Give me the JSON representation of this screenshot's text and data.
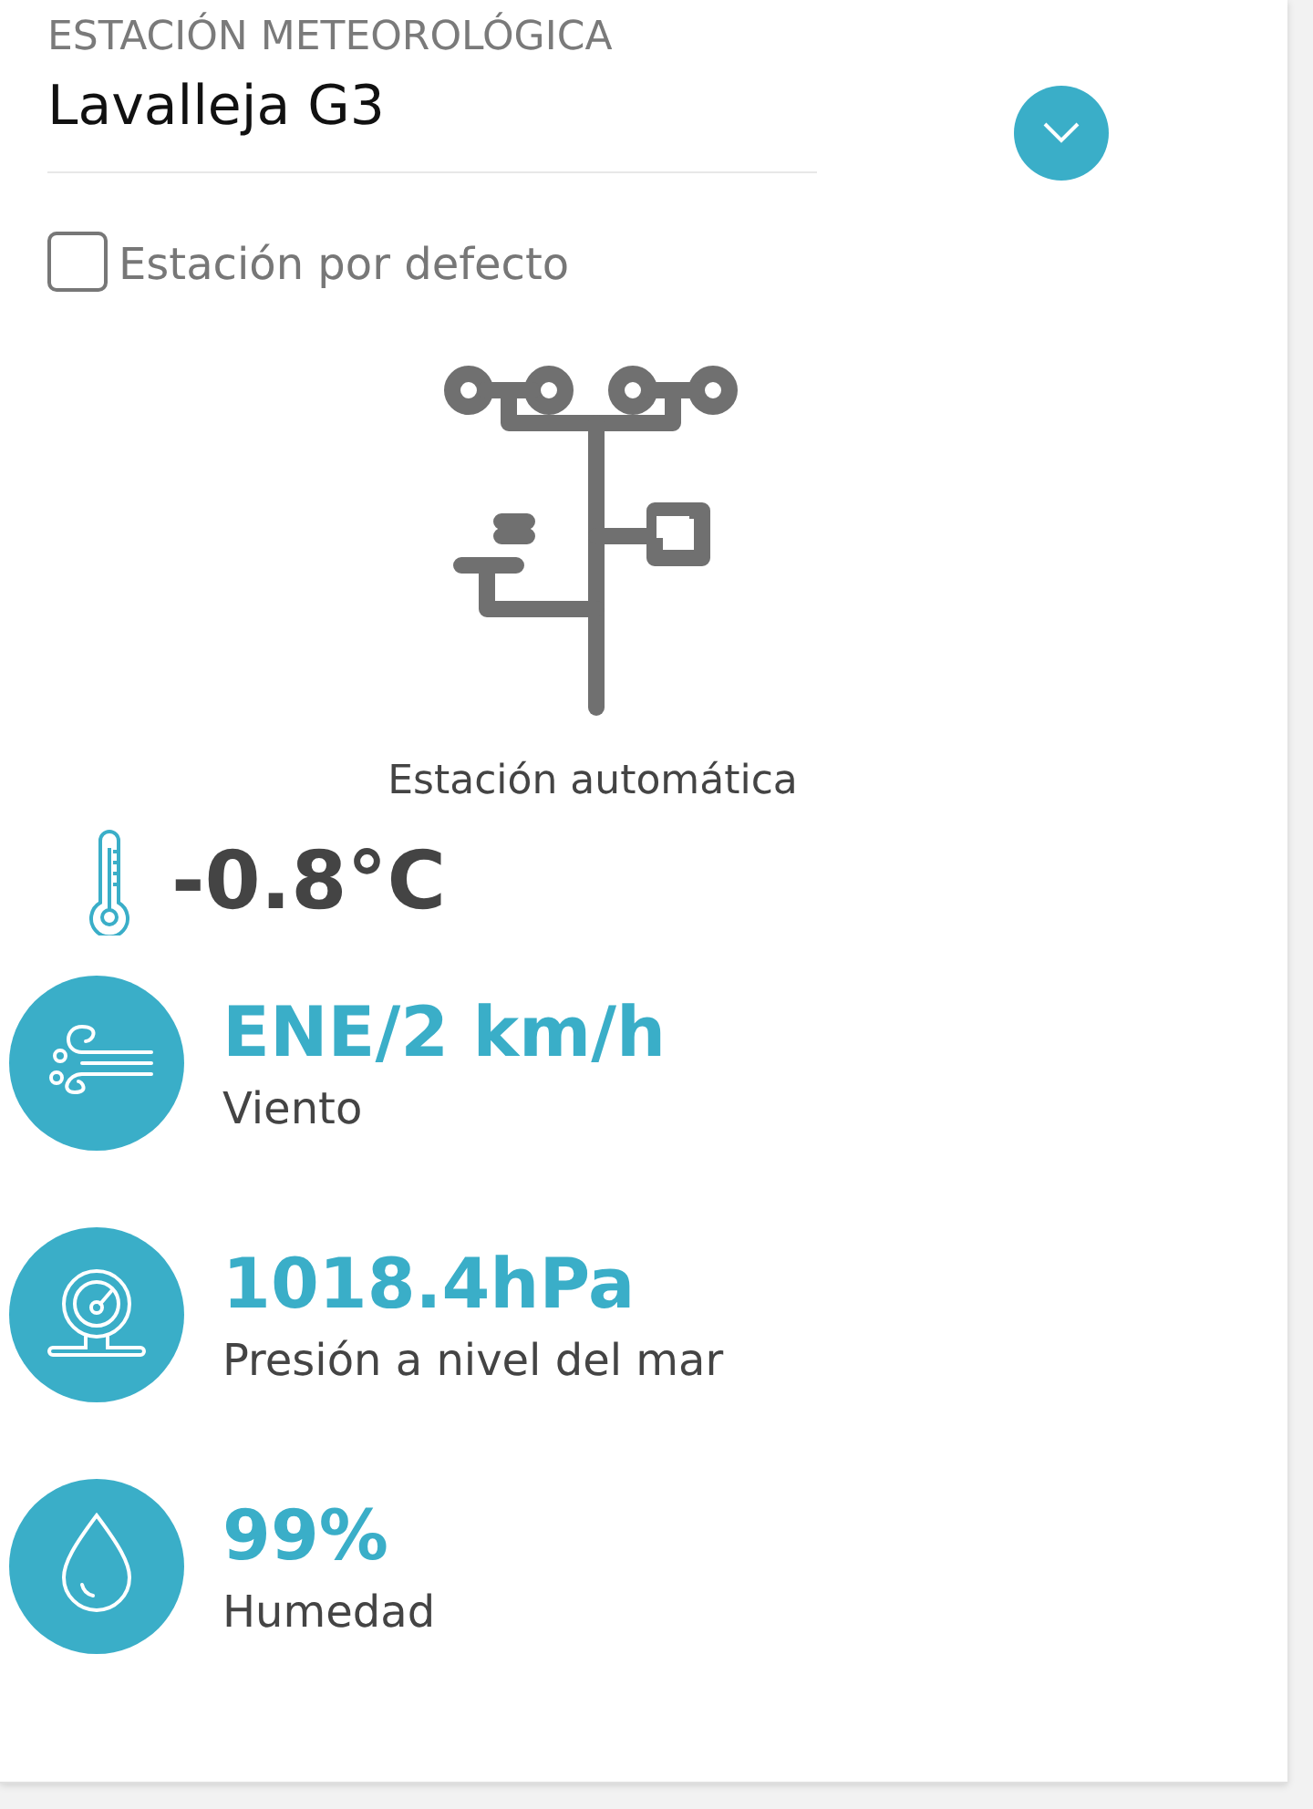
{
  "station": {
    "label": "ESTACIÓN METEOROLÓGICA",
    "name": "Lavalleja G3"
  },
  "default_station": {
    "label": "Estación por defecto",
    "checked": false
  },
  "station_type": "Estación automática",
  "temperature": "-0.8°C",
  "metrics": [
    {
      "kind": "wind",
      "value": "ENE/2 km/h",
      "label": "Viento"
    },
    {
      "kind": "pressure",
      "value": "1018.4hPa",
      "label": "Presión a nivel del mar"
    },
    {
      "kind": "humidity",
      "value": "99%",
      "label": "Humedad"
    }
  ]
}
